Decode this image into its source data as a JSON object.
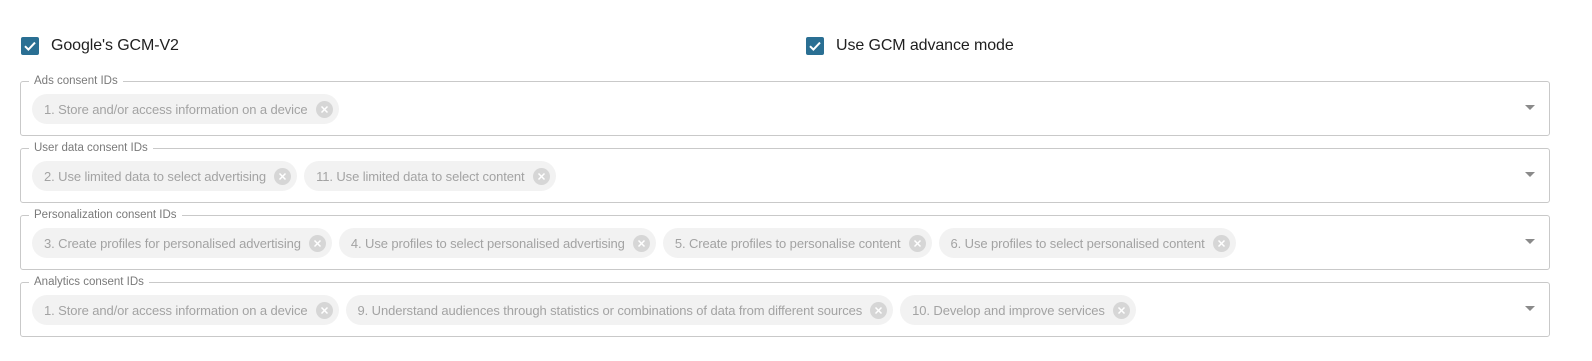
{
  "options": {
    "gcm_v2": {
      "label": "Google's GCM-V2",
      "checked": true
    },
    "gcm_advance": {
      "label": "Use GCM advance mode",
      "checked": true
    }
  },
  "fields": {
    "ads": {
      "legend": "Ads consent IDs",
      "chips": [
        "1. Store and/or access information on a device"
      ]
    },
    "user_data": {
      "legend": "User data consent IDs",
      "chips": [
        "2. Use limited data to select advertising",
        "11. Use limited data to select content"
      ]
    },
    "personalization": {
      "legend": "Personalization consent IDs",
      "chips": [
        "3. Create profiles for personalised advertising",
        "4. Use profiles to select personalised advertising",
        "5. Create profiles to personalise content",
        "6. Use profiles to select personalised content"
      ]
    },
    "analytics": {
      "legend": "Analytics consent IDs",
      "chips": [
        "1. Store and/or access information on a device",
        "9. Understand audiences through statistics or combinations of data from different sources",
        "10. Develop and improve services"
      ]
    }
  },
  "icons": {
    "checkbox": "check-icon",
    "chip_remove": "close-circle-icon",
    "dropdown": "chevron-down-icon"
  },
  "colors": {
    "checkbox": "#2a6f93",
    "chip_bg": "#f2f2f2",
    "chip_text": "#a3a3a3",
    "border": "#c9c9c9"
  }
}
